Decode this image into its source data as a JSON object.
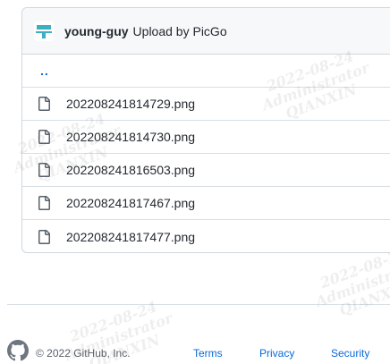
{
  "header": {
    "author": "young-guy",
    "message": "Upload by PicGo"
  },
  "parent_link": "..",
  "files": [
    {
      "name": "202208241814729.png",
      "icon": "file-icon"
    },
    {
      "name": "202208241814730.png",
      "icon": "file-icon"
    },
    {
      "name": "202208241816503.png",
      "icon": "file-icon"
    },
    {
      "name": "202208241817467.png",
      "icon": "file-icon"
    },
    {
      "name": "202208241817477.png",
      "icon": "file-icon"
    }
  ],
  "footer": {
    "copyright": "© 2022 GitHub, Inc.",
    "links": [
      "Terms",
      "Privacy",
      "Security"
    ]
  },
  "watermark": {
    "date": "2022-08-24",
    "user": "Administrator",
    "org": "QIANXIN"
  },
  "colors": {
    "link": "#0969da",
    "border": "#d0d7de",
    "header_bg": "#f6f8fa",
    "avatar_accent": "#3ab0c3"
  }
}
